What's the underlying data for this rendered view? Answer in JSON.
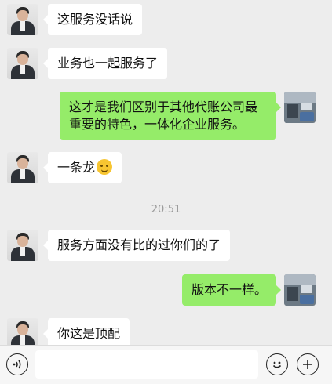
{
  "messages": [
    {
      "side": "left",
      "text": "这服务没话说"
    },
    {
      "side": "left",
      "text": "业务也一起服务了"
    },
    {
      "side": "right",
      "lines": [
        "这才是我们区别于其他代账公司最",
        "重要的特色，一体化企业服务。"
      ]
    },
    {
      "side": "left",
      "text": "一条龙",
      "emoji": "thinking-face-emoji"
    },
    {
      "timestamp": "20:51"
    },
    {
      "side": "left",
      "text": "服务方面没有比的过你们的了"
    },
    {
      "side": "right",
      "text": "版本不一样。"
    },
    {
      "side": "left",
      "text": "你这是顶配"
    }
  ],
  "colors": {
    "sent_bubble": "#95ec69",
    "received_bubble": "#ffffff",
    "background": "#ededed"
  },
  "input_bar": {
    "voice_icon": "voice-icon",
    "emoji_icon": "emoji-icon",
    "plus_icon": "plus-icon",
    "input_value": ""
  }
}
